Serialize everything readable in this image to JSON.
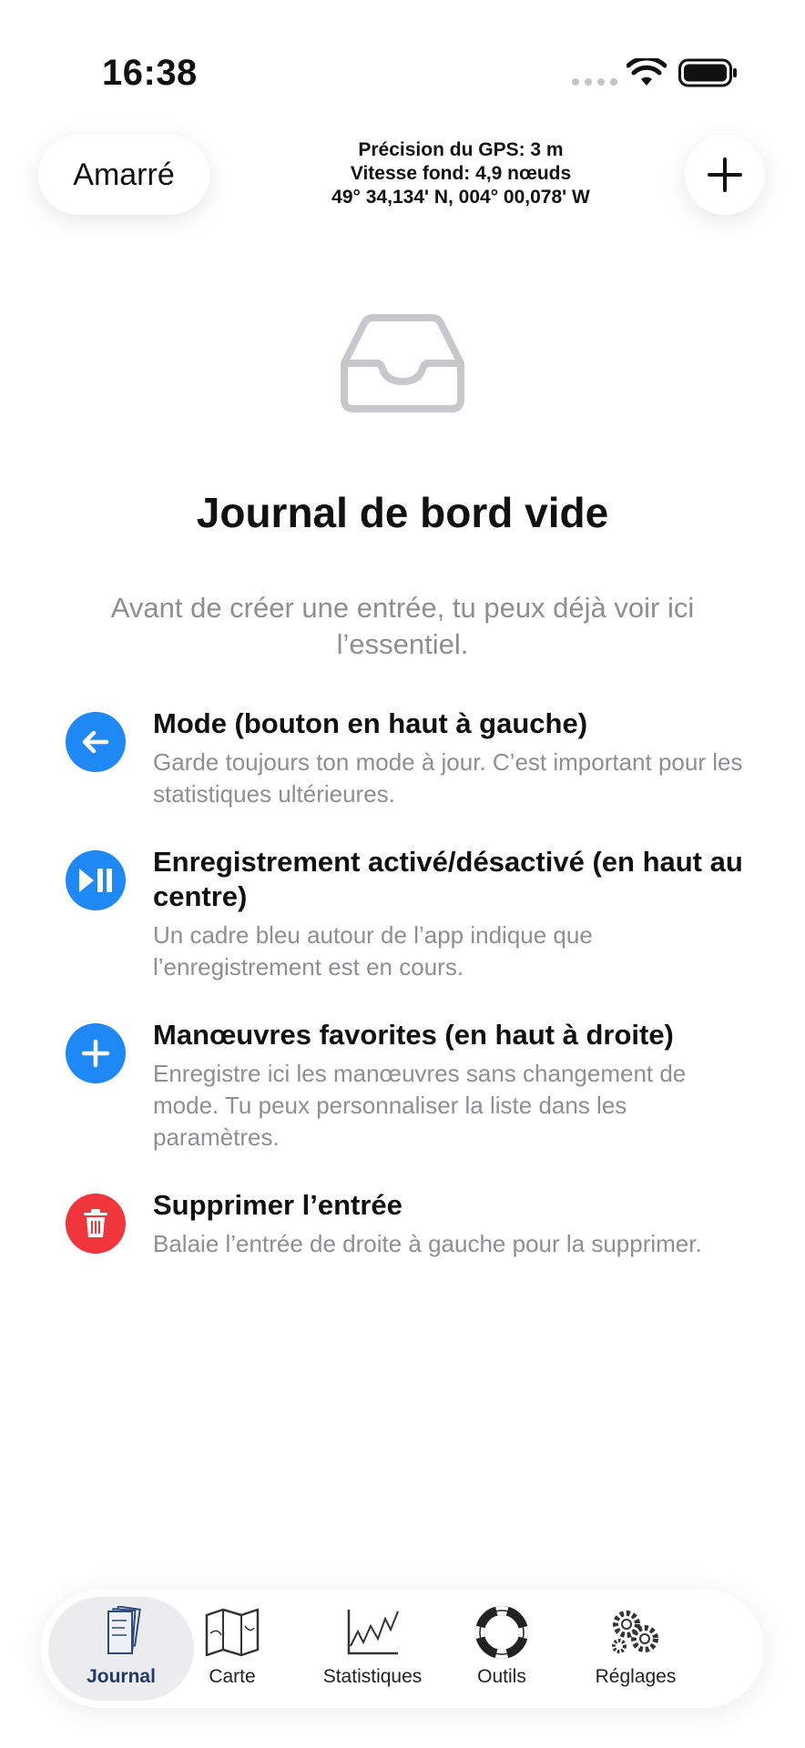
{
  "status_bar": {
    "time": "16:38"
  },
  "header": {
    "mode_label": "Amarré",
    "gps_precision": "Précision du GPS: 3 m",
    "speed": "Vitesse fond: 4,9 nœuds",
    "position": "49° 34,134' N, 004° 00,078' W",
    "add_icon": "plus-icon"
  },
  "empty_state": {
    "icon": "inbox-tray-icon",
    "title": "Journal de bord vide",
    "description": "Avant de créer une entrée, tu peux déjà voir ici l’essentiel."
  },
  "tips": [
    {
      "icon": "arrow-left-icon",
      "color": "#1e88f5",
      "title": "Mode (bouton en haut à gauche)",
      "description": "Garde toujours ton mode à jour. C’est important pour les statistiques ultérieures."
    },
    {
      "icon": "play-pause-icon",
      "color": "#1e88f5",
      "title": "Enregistrement activé/désactivé (en haut au centre)",
      "description": "Un cadre bleu autour de l’app indique que l’enregistrement est en cours."
    },
    {
      "icon": "plus-icon",
      "color": "#1e88f5",
      "title": "Manœuvres favorites (en haut à droite)",
      "description": "Enregistre ici les manœuvres sans changement de mode. Tu peux personnaliser la liste dans les paramètres."
    },
    {
      "icon": "trash-icon",
      "color": "#f0353d",
      "title": "Supprimer l’entrée",
      "description": "Balaie l’entrée de droite à gauche pour la supprimer."
    }
  ],
  "tab_bar": {
    "active": "Journal",
    "tabs": [
      {
        "label": "Journal",
        "icon": "logbook-icon"
      },
      {
        "label": "Carte",
        "icon": "map-icon"
      },
      {
        "label": "Statistiques",
        "icon": "chart-icon"
      },
      {
        "label": "Outils",
        "icon": "lifebuoy-icon"
      },
      {
        "label": "Réglages",
        "icon": "gears-icon"
      }
    ]
  }
}
